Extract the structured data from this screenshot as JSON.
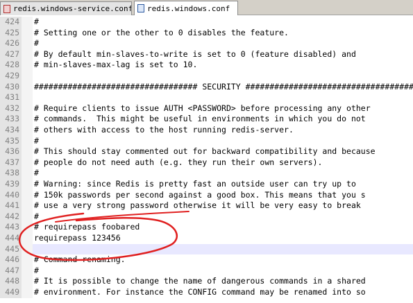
{
  "tabs": [
    {
      "label": "redis.windows-service.conf",
      "active": false,
      "icon": "red-file-icon"
    },
    {
      "label": "redis.windows.conf",
      "active": true,
      "icon": "blue-file-icon"
    }
  ],
  "lines": [
    {
      "num": "424",
      "text": "#"
    },
    {
      "num": "425",
      "text": "# Setting one or the other to 0 disables the feature."
    },
    {
      "num": "426",
      "text": "#"
    },
    {
      "num": "427",
      "text": "# By default min-slaves-to-write is set to 0 (feature disabled) and"
    },
    {
      "num": "428",
      "text": "# min-slaves-max-lag is set to 10."
    },
    {
      "num": "429",
      "text": ""
    },
    {
      "num": "430",
      "text": "################################## SECURITY ###################################"
    },
    {
      "num": "431",
      "text": ""
    },
    {
      "num": "432",
      "text": "# Require clients to issue AUTH <PASSWORD> before processing any other"
    },
    {
      "num": "433",
      "text": "# commands.  This might be useful in environments in which you do not"
    },
    {
      "num": "434",
      "text": "# others with access to the host running redis-server."
    },
    {
      "num": "435",
      "text": "#"
    },
    {
      "num": "436",
      "text": "# This should stay commented out for backward compatibility and because"
    },
    {
      "num": "437",
      "text": "# people do not need auth (e.g. they run their own servers)."
    },
    {
      "num": "438",
      "text": "#"
    },
    {
      "num": "439",
      "text": "# Warning: since Redis is pretty fast an outside user can try up to"
    },
    {
      "num": "440",
      "text": "# 150k passwords per second against a good box. This means that you s"
    },
    {
      "num": "441",
      "text": "# use a very strong password otherwise it will be very easy to break"
    },
    {
      "num": "442",
      "text": "#"
    },
    {
      "num": "443",
      "text": "# requirepass foobared"
    },
    {
      "num": "444",
      "text": "requirepass 123456"
    },
    {
      "num": "445",
      "text": ""
    },
    {
      "num": "446",
      "text": "# Command renaming."
    },
    {
      "num": "447",
      "text": "#"
    },
    {
      "num": "448",
      "text": "# It is possible to change the name of dangerous commands in a shared"
    },
    {
      "num": "449",
      "text": "# environment. For instance the CONFIG command may be renamed into so"
    }
  ],
  "current_line": "445",
  "colors": {
    "annotation": "#e02020",
    "current_line_bg": "#e8e8ff"
  }
}
